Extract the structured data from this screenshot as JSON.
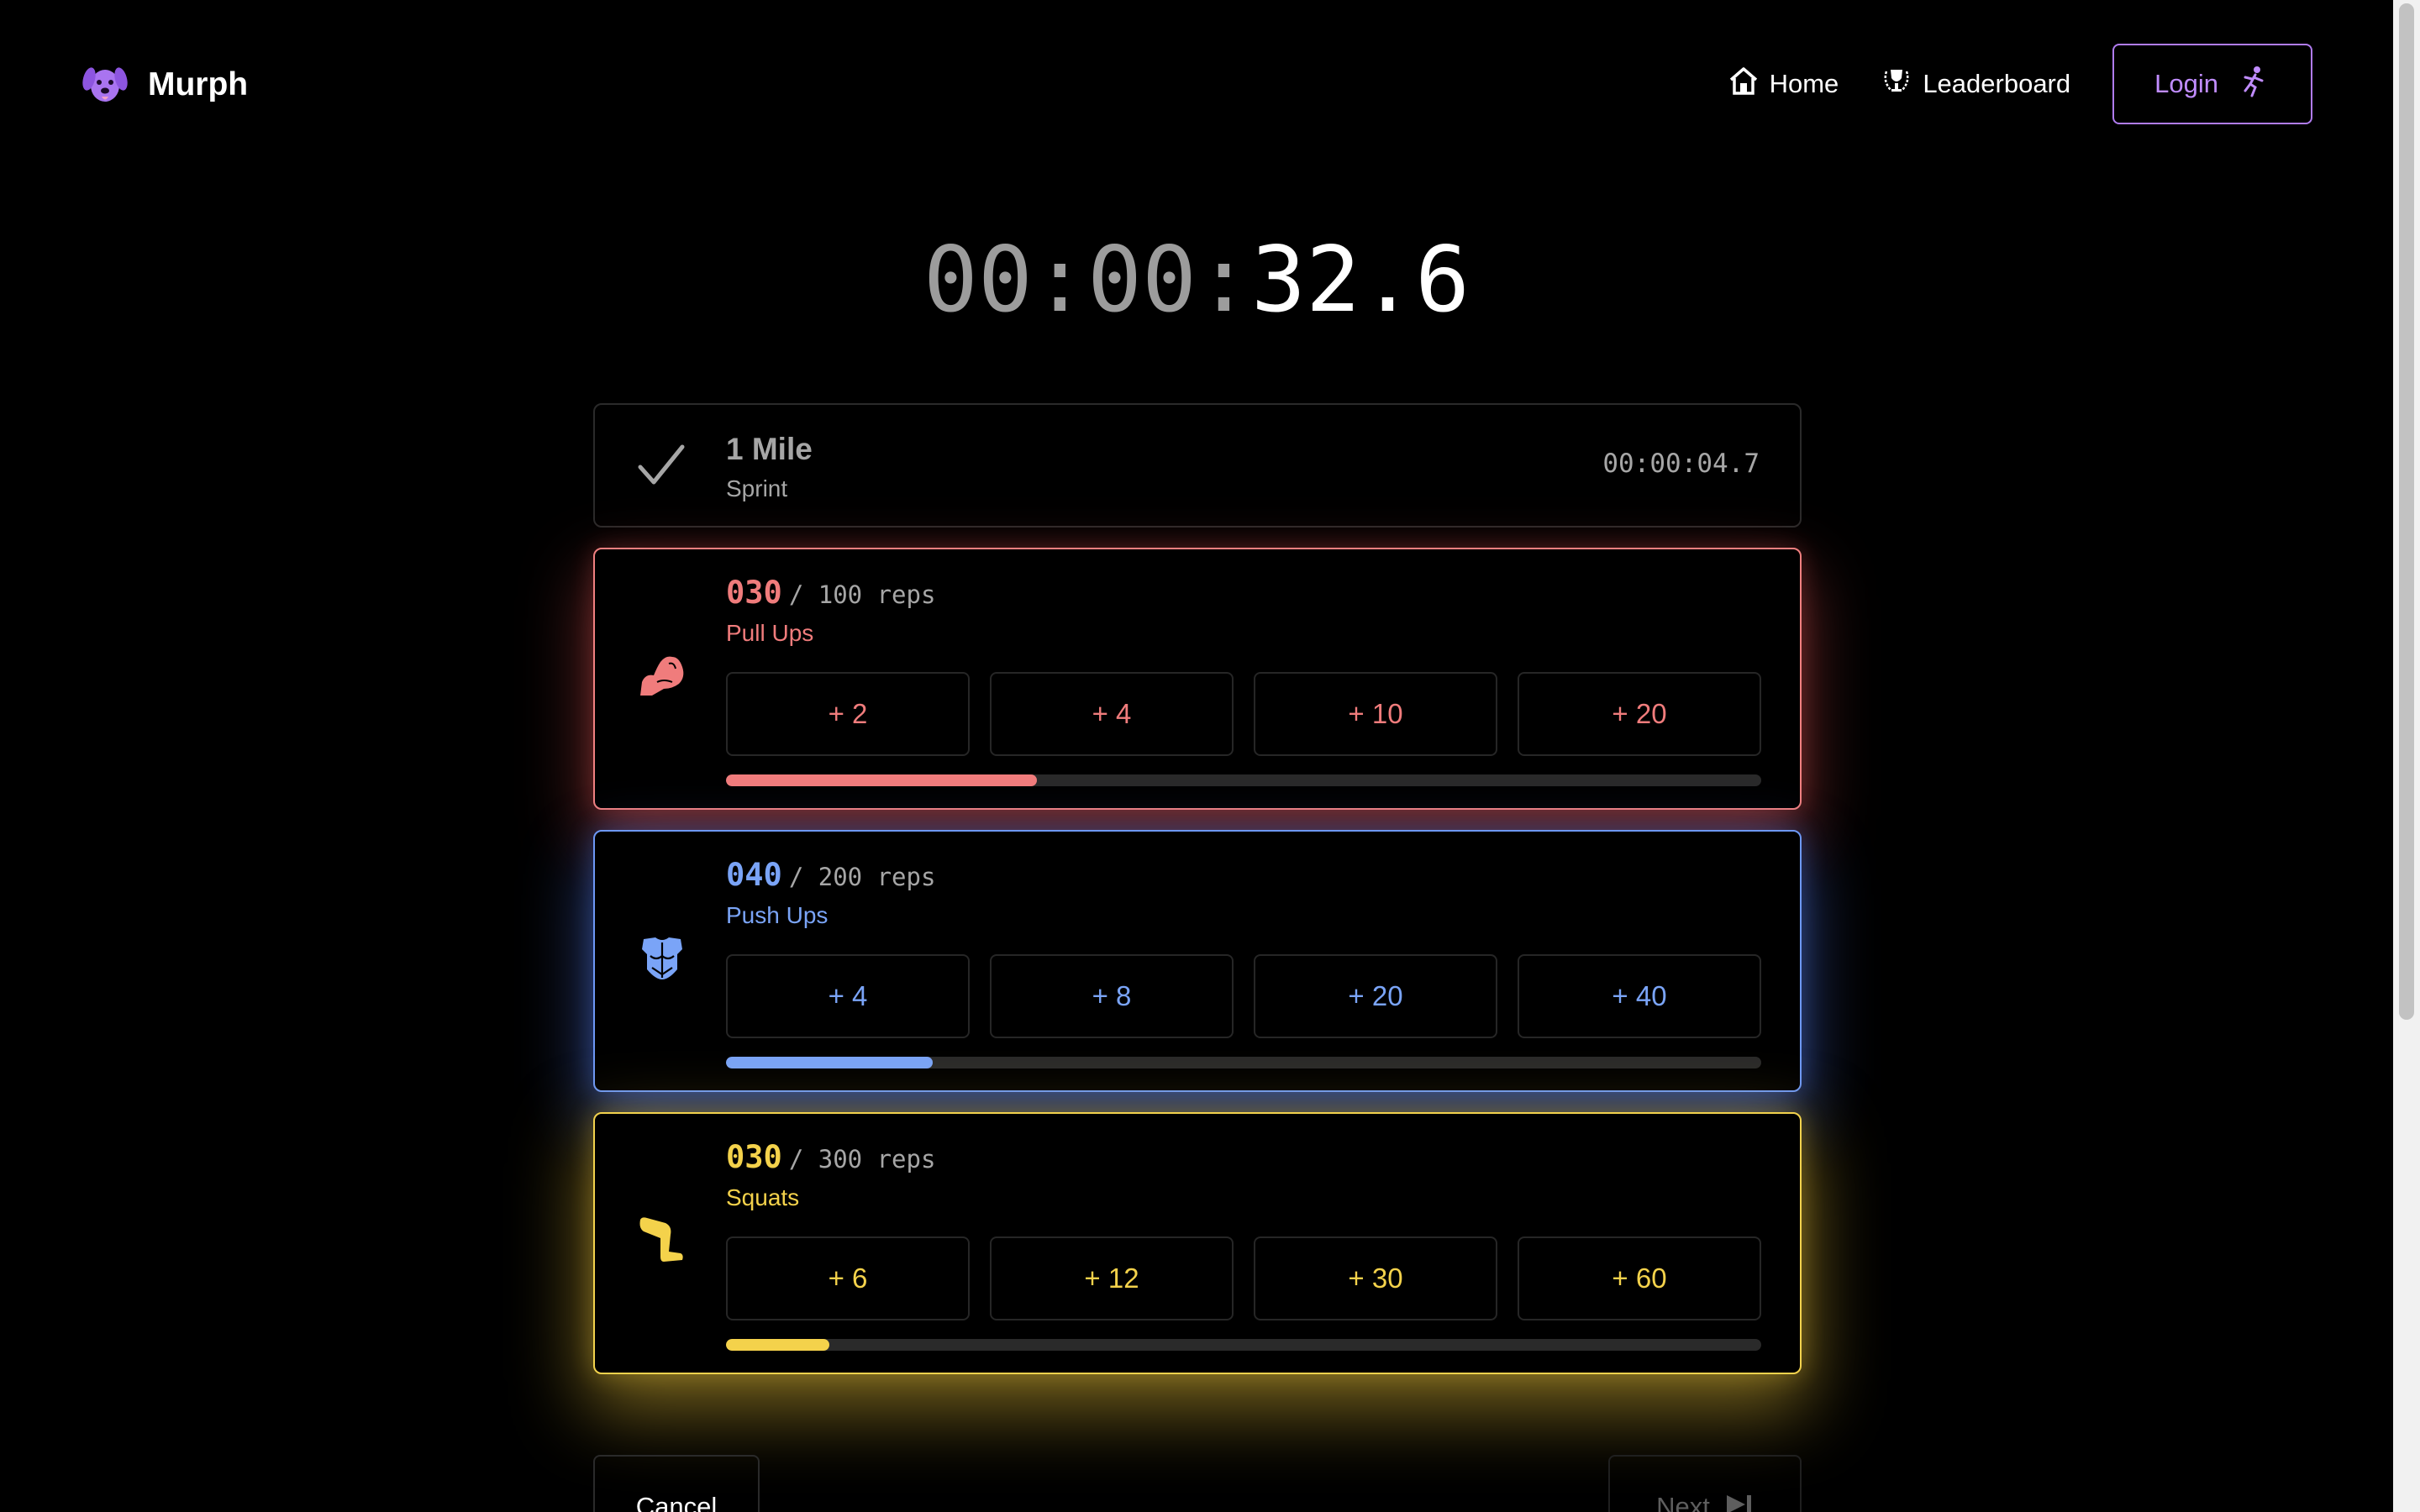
{
  "nav": {
    "brand": "Murph",
    "home_label": "Home",
    "leaderboard_label": "Leaderboard",
    "login_label": "Login"
  },
  "timer": {
    "dim": "00:00:",
    "bright": "32.6"
  },
  "completed": {
    "title": "1 Mile",
    "subtitle": "Sprint",
    "time": "00:00:04.7"
  },
  "exercises": [
    {
      "count": "030",
      "total": "/ 100 reps",
      "name": "Pull Ups",
      "color": "#f07c7c",
      "icon": "flexed-arm-icon",
      "increments": [
        "+ 2",
        "+ 4",
        "+ 10",
        "+ 20"
      ],
      "progress": 0.3
    },
    {
      "count": "040",
      "total": "/ 200 reps",
      "name": "Push Ups",
      "color": "#7aa4f7",
      "icon": "chest-armor-icon",
      "increments": [
        "+ 4",
        "+ 8",
        "+ 20",
        "+ 40"
      ],
      "progress": 0.2
    },
    {
      "count": "030",
      "total": "/ 300 reps",
      "name": "Squats",
      "color": "#f4d24b",
      "icon": "leg-icon",
      "increments": [
        "+ 6",
        "+ 12",
        "+ 30",
        "+ 60"
      ],
      "progress": 0.1
    }
  ],
  "footer": {
    "cancel_label": "Cancel",
    "next_label": "Next"
  }
}
